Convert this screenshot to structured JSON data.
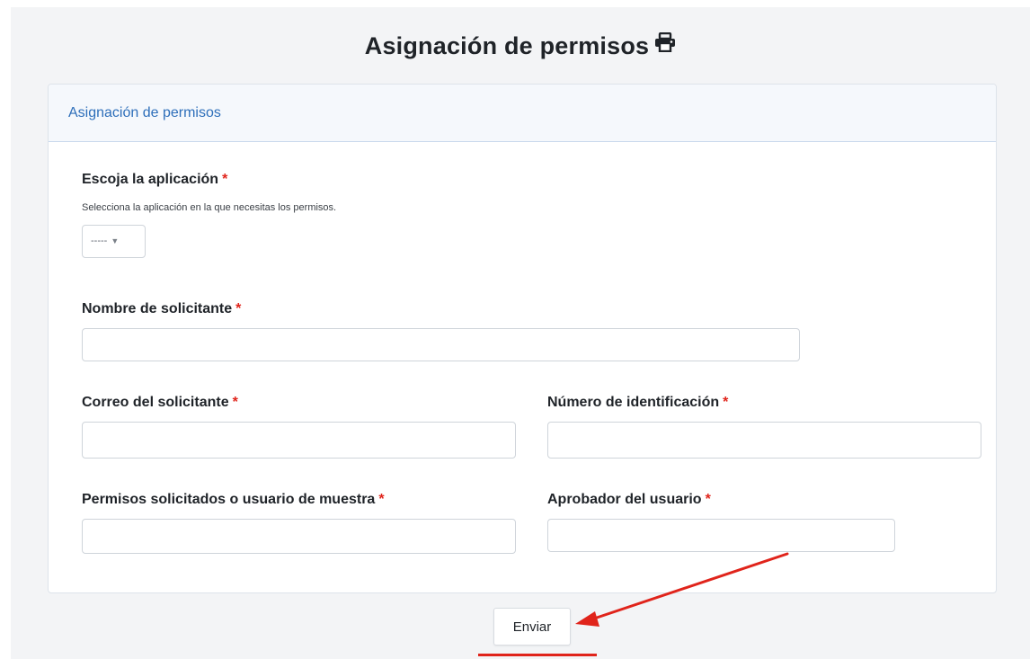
{
  "page": {
    "title": "Asignación de permisos",
    "title_icon": "print-icon"
  },
  "card": {
    "header": "Asignación de permisos"
  },
  "form": {
    "required_marker": "*",
    "application": {
      "label": "Escoja la aplicación",
      "help": "Selecciona la aplicación en la que necesitas los permisos.",
      "selected": "-----"
    },
    "requester_name": {
      "label": "Nombre de solicitante",
      "value": ""
    },
    "requester_email": {
      "label": "Correo del solicitante",
      "value": ""
    },
    "id_number": {
      "label": "Número de identificación",
      "value": ""
    },
    "permissions": {
      "label": "Permisos solicitados o usuario de muestra",
      "value": ""
    },
    "approver": {
      "label": "Aprobador del usuario",
      "value": ""
    },
    "submit_label": "Enviar"
  },
  "colors": {
    "accent_link": "#2e6fba",
    "required": "#e0241b",
    "annotation": "#e0241b"
  }
}
